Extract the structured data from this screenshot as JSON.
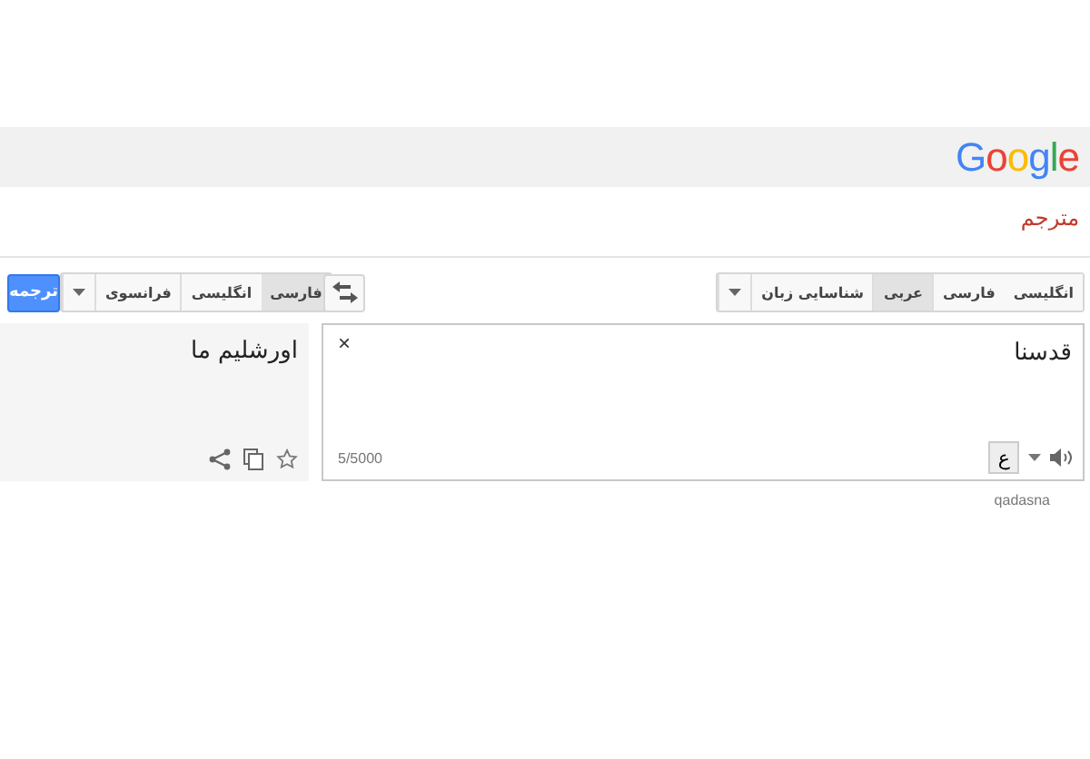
{
  "header": {
    "logo": "Google"
  },
  "title": "مترجم",
  "source_languages": [
    {
      "label": "انگلیسی",
      "selected": false
    },
    {
      "label": "فارسی",
      "selected": false
    },
    {
      "label": "عربی",
      "selected": true
    },
    {
      "label": "شناسایی زبان",
      "selected": false
    }
  ],
  "target_languages": [
    {
      "label": "فارسی",
      "selected": true
    },
    {
      "label": "انگلیسی",
      "selected": false
    },
    {
      "label": "فرانسوی",
      "selected": false
    }
  ],
  "translate_button": "ترجمه",
  "input": {
    "value": "قدسنا",
    "clear": "×",
    "char_count": "5/5000",
    "keyboard": "ع"
  },
  "output": {
    "text": "اورشلیم ما"
  },
  "transliteration": "qadasna"
}
